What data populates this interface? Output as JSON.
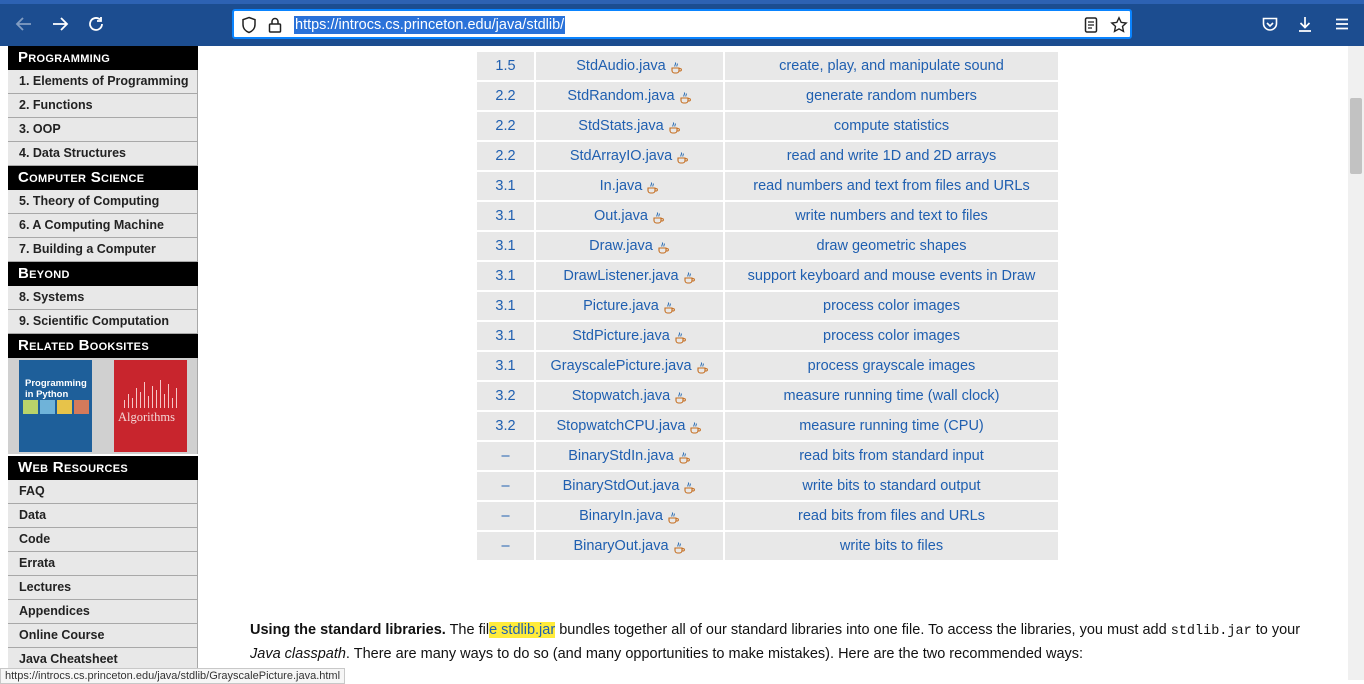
{
  "browser": {
    "url": "https://introcs.cs.princeton.edu/java/stdlib/",
    "status_url": "https://introcs.cs.princeton.edu/java/stdlib/GrayscalePicture.java.html"
  },
  "sidebar": {
    "sections": [
      {
        "title": "Programming",
        "items": [
          "1.  Elements of Programming",
          "2.  Functions",
          "3.  OOP",
          "4.  Data Structures"
        ]
      },
      {
        "title": "Computer Science",
        "items": [
          "5.  Theory of Computing",
          "6.  A Computing Machine",
          "7.  Building a Computer"
        ]
      },
      {
        "title": "Beyond",
        "items": [
          "8.  Systems",
          "9.  Scientific Computation"
        ]
      },
      {
        "title": "Related Booksites",
        "books": [
          "Programming in Python",
          "Algorithms"
        ]
      },
      {
        "title": "Web Resources",
        "items": [
          "FAQ",
          "Data",
          "Code",
          "Errata",
          "Lectures",
          "Appendices",
          "Online Course",
          "Java Cheatsheet"
        ]
      }
    ]
  },
  "table": {
    "rows": [
      {
        "section": "1.5",
        "file": "StdAudio.java",
        "desc": "create, play, and manipulate sound"
      },
      {
        "section": "2.2",
        "file": "StdRandom.java",
        "desc": "generate random numbers"
      },
      {
        "section": "2.2",
        "file": "StdStats.java",
        "desc": "compute statistics"
      },
      {
        "section": "2.2",
        "file": "StdArrayIO.java",
        "desc": "read and write 1D and 2D arrays"
      },
      {
        "section": "3.1",
        "file": "In.java",
        "desc": "read numbers and text from files and URLs"
      },
      {
        "section": "3.1",
        "file": "Out.java",
        "desc": "write numbers and text to files"
      },
      {
        "section": "3.1",
        "file": "Draw.java",
        "desc": "draw geometric shapes"
      },
      {
        "section": "3.1",
        "file": "DrawListener.java",
        "desc": "support keyboard and mouse events in Draw"
      },
      {
        "section": "3.1",
        "file": "Picture.java",
        "desc": "process color images"
      },
      {
        "section": "3.1",
        "file": "StdPicture.java",
        "desc": "process color images"
      },
      {
        "section": "3.1",
        "file": "GrayscalePicture.java",
        "desc": "process grayscale images"
      },
      {
        "section": "3.2",
        "file": "Stopwatch.java",
        "desc": "measure running time (wall clock)"
      },
      {
        "section": "3.2",
        "file": "StopwatchCPU.java",
        "desc": "measure running time (CPU)"
      },
      {
        "section": "–",
        "file": "BinaryStdIn.java",
        "desc": "read bits from standard input"
      },
      {
        "section": "–",
        "file": "BinaryStdOut.java",
        "desc": "write bits to standard output"
      },
      {
        "section": "–",
        "file": "BinaryIn.java",
        "desc": "read bits from files and URLs"
      },
      {
        "section": "–",
        "file": "BinaryOut.java",
        "desc": "write bits to files"
      }
    ]
  },
  "paragraph": {
    "heading": "Using the standard libraries.",
    "t1": " The fil",
    "highlight": "e stdlib.jar",
    "t2": " bundles together all of our standard libraries into one file. To access the libraries, you must add ",
    "code": "stdlib.jar",
    "t3": " to your ",
    "italic": "Java classpath",
    "t4": ". There are many ways to do so (and many opportunities to make mistakes). Here are the two recommended ways:"
  },
  "colors": {
    "link": "#1f5fb0",
    "chrome": "#1c4d90",
    "cell_bg": "#e8e8e8",
    "highlight": "#ffeb3b"
  }
}
